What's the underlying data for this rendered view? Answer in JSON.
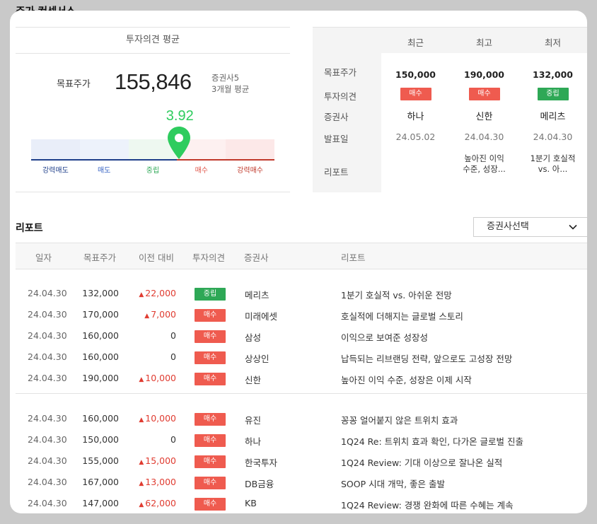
{
  "page_title": "주가 컨센서스",
  "consensus": {
    "header": "투자의견 평균",
    "target_label": "목표주가",
    "target_value": "155,846",
    "broker_count": "증권사5",
    "period": "3개월 평균",
    "score": "3.92",
    "score_position": 0.607,
    "scale_labels": [
      "강력매도",
      "매도",
      "중립",
      "매수",
      "강력매수"
    ],
    "scale_colors": [
      "#1f3f8a",
      "#3a66c4",
      "#2ea856",
      "#e0564a",
      "#c0392b"
    ]
  },
  "summary": {
    "columns": [
      "최근",
      "최고",
      "최저"
    ],
    "row_labels": [
      "목표주가",
      "투자의견",
      "증권사",
      "발표일",
      "리포트"
    ],
    "recent": {
      "target": "150,000",
      "opinion": "매수",
      "opinion_type": "buy",
      "broker": "하나",
      "date": "24.05.02",
      "report": ""
    },
    "high": {
      "target": "190,000",
      "opinion": "매수",
      "opinion_type": "buy",
      "broker": "신한",
      "date": "24.04.30",
      "report_line1": "높아진 이익",
      "report_line2": "수준, 성장..."
    },
    "low": {
      "target": "132,000",
      "opinion": "중립",
      "opinion_type": "neutral",
      "broker": "메리츠",
      "date": "24.04.30",
      "report_line1": "1분기 호실적",
      "report_line2": "vs. 아..."
    }
  },
  "reports": {
    "title": "리포트",
    "select_label": "증권사선택",
    "headers": [
      "일자",
      "목표주가",
      "이전 대비",
      "투자의견",
      "증권사",
      "리포트"
    ],
    "rows": [
      {
        "date": "24.04.30",
        "target": "132,000",
        "change": "22,000",
        "up": true,
        "opinion": "중립",
        "type": "neutral",
        "broker": "메리츠",
        "title": "1분기 호실적 vs. 아쉬운 전망"
      },
      {
        "date": "24.04.30",
        "target": "170,000",
        "change": "7,000",
        "up": true,
        "opinion": "매수",
        "type": "buy",
        "broker": "미래에셋",
        "title": "호실적에 더해지는 글로벌 스토리"
      },
      {
        "date": "24.04.30",
        "target": "160,000",
        "change": "0",
        "up": false,
        "opinion": "매수",
        "type": "buy",
        "broker": "삼성",
        "title": "이익으로 보여준 성장성"
      },
      {
        "date": "24.04.30",
        "target": "160,000",
        "change": "0",
        "up": false,
        "opinion": "매수",
        "type": "buy",
        "broker": "상상인",
        "title": "납득되는 리브랜딩 전략, 앞으로도 고성장 전망"
      },
      {
        "date": "24.04.30",
        "target": "190,000",
        "change": "10,000",
        "up": true,
        "opinion": "매수",
        "type": "buy",
        "broker": "신한",
        "title": "높아진 이익 수준, 성장은 이제 시작"
      },
      {
        "date": "24.04.30",
        "target": "160,000",
        "change": "10,000",
        "up": true,
        "opinion": "매수",
        "type": "buy",
        "broker": "유진",
        "title": "꽁꽁 얼어붙지 않은 트위치 효과"
      },
      {
        "date": "24.04.30",
        "target": "150,000",
        "change": "0",
        "up": false,
        "opinion": "매수",
        "type": "buy",
        "broker": "하나",
        "title": "1Q24 Re: 트위치 효과 확인, 다가온 글로벌 진출"
      },
      {
        "date": "24.04.30",
        "target": "155,000",
        "change": "15,000",
        "up": true,
        "opinion": "매수",
        "type": "buy",
        "broker": "한국투자",
        "title": "1Q24 Review: 기대 이상으로 잘나온 실적"
      },
      {
        "date": "24.04.30",
        "target": "167,000",
        "change": "13,000",
        "up": true,
        "opinion": "매수",
        "type": "buy",
        "broker": "DB금융",
        "title": "SOOP 시대 개막, 좋은 출발"
      },
      {
        "date": "24.04.30",
        "target": "147,000",
        "change": "62,000",
        "up": true,
        "opinion": "매수",
        "type": "buy",
        "broker": "KB",
        "title": "1Q24 Review: 경쟁 완화에 따른 수혜는 계속"
      }
    ]
  }
}
